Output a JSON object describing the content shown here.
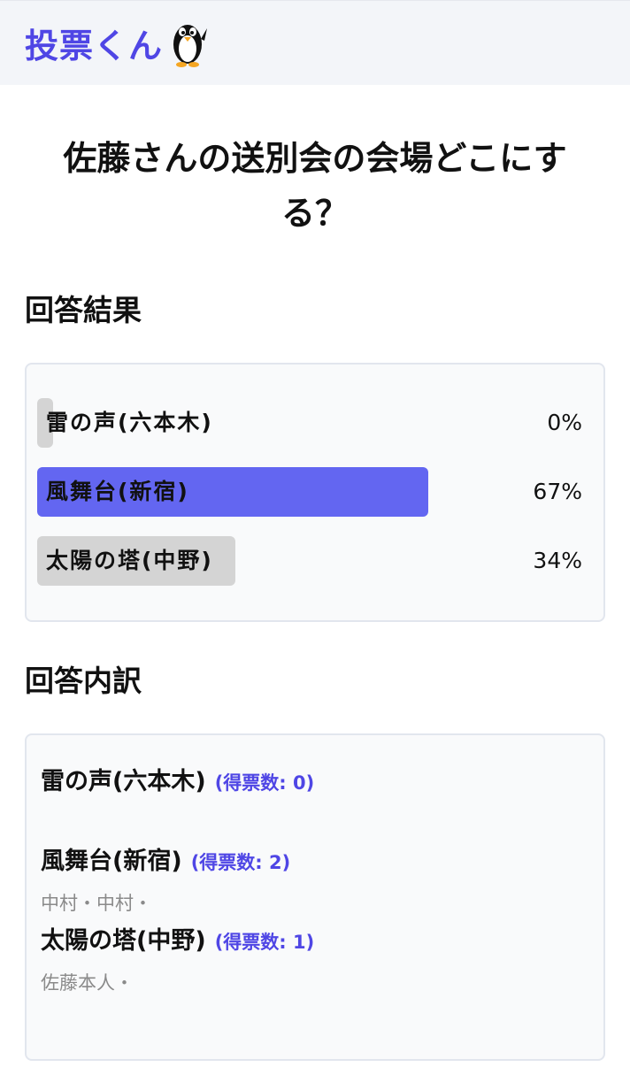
{
  "header": {
    "app_title": "投票くん",
    "logo_icon": "penguin-icon"
  },
  "question": "佐藤さんの送別会の会場どこにする？",
  "results": {
    "section_title": "回答結果",
    "items": [
      {
        "label": "雷の声(六本木)",
        "percent": 0,
        "percent_text": "0%",
        "highlight": false
      },
      {
        "label": "風舞台(新宿)",
        "percent": 67,
        "percent_text": "67%",
        "highlight": true
      },
      {
        "label": "太陽の塔(中野)",
        "percent": 34,
        "percent_text": "34%",
        "highlight": false
      }
    ]
  },
  "breakdown": {
    "section_title": "回答内訳",
    "items": [
      {
        "name": "雷の声(六本木)",
        "votes": "(得票数: 0)",
        "voters": ""
      },
      {
        "name": "風舞台(新宿)",
        "votes": "(得票数: 2)",
        "voters": "中村・中村・"
      },
      {
        "name": "太陽の塔(中野)",
        "votes": "(得票数: 1)",
        "voters": "佐藤本人・"
      }
    ]
  },
  "colors": {
    "accent": "#4f46e5",
    "bar_lead": "#6366f1",
    "bar_other": "#d4d4d4"
  }
}
